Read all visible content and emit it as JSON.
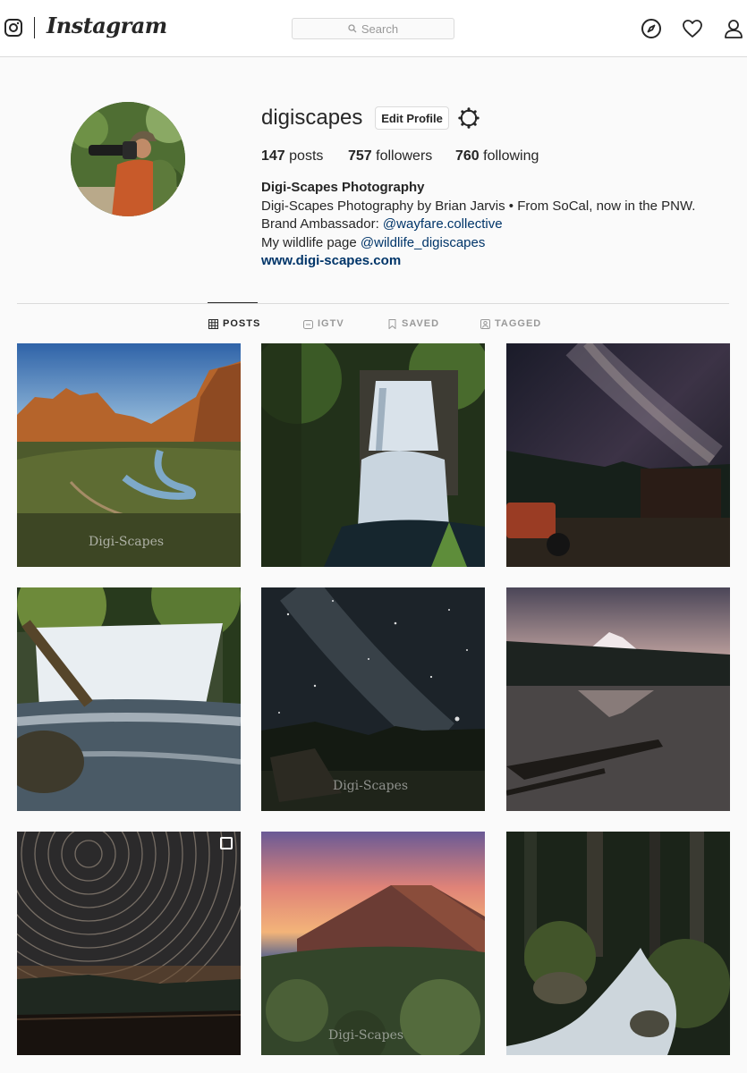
{
  "nav": {
    "brand": "Instagram",
    "search_placeholder": "Search",
    "icons": [
      "instagram-glyph-icon",
      "search-icon",
      "compass-icon",
      "heart-icon",
      "user-icon"
    ]
  },
  "profile": {
    "username": "digiscapes",
    "edit_profile_label": "Edit Profile",
    "stats": {
      "posts_count": "147",
      "posts_label": " posts",
      "followers_count": "757",
      "followers_label": " followers",
      "following_count": "760",
      "following_label": " following"
    },
    "full_name": "Digi-Scapes Photography",
    "bio_line1": "Digi-Scapes Photography by Brian Jarvis • From SoCal, now in the PNW.",
    "bio_line2_prefix": "Brand Ambassador: ",
    "bio_line2_link": "@wayfare.collective",
    "bio_line3_prefix": "My wildlife page ",
    "bio_line3_link": "@wildlife_digiscapes",
    "website": "www.digi-scapes.com"
  },
  "tabs": [
    {
      "label": "POSTS",
      "active": true,
      "icon": "grid-icon"
    },
    {
      "label": "IGTV",
      "active": false,
      "icon": "igtv-icon"
    },
    {
      "label": "SAVED",
      "active": false,
      "icon": "bookmark-icon"
    },
    {
      "label": "TAGGED",
      "active": false,
      "icon": "tag-icon"
    }
  ],
  "posts": {
    "watermark": "Digi-Scapes",
    "items": [
      {
        "subject": "canyon river at sunset"
      },
      {
        "subject": "forest waterfall"
      },
      {
        "subject": "milky way over farm"
      },
      {
        "subject": "cascading waterfall"
      },
      {
        "subject": "starry sky over barn"
      },
      {
        "subject": "mountain lake reflection"
      },
      {
        "subject": "star trails",
        "multi_photo": true
      },
      {
        "subject": "volcano at sunset"
      },
      {
        "subject": "forest stream"
      }
    ]
  },
  "colors": {
    "text": "#262626",
    "link": "#003569",
    "muted": "#999999",
    "border": "#dbdbdb",
    "background": "#fafafa"
  }
}
